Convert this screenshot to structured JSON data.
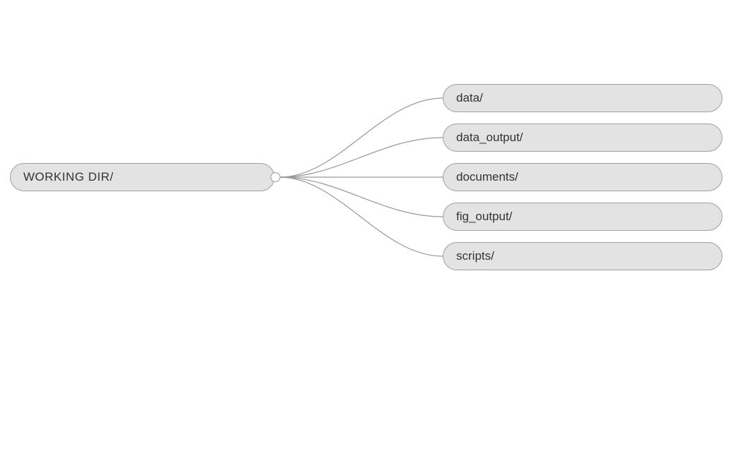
{
  "diagram": {
    "root": {
      "label": "WORKING DIR/"
    },
    "children": [
      {
        "label": "data/"
      },
      {
        "label": "data_output/"
      },
      {
        "label": "documents/"
      },
      {
        "label": "fig_output/"
      },
      {
        "label": "scripts/"
      }
    ]
  }
}
